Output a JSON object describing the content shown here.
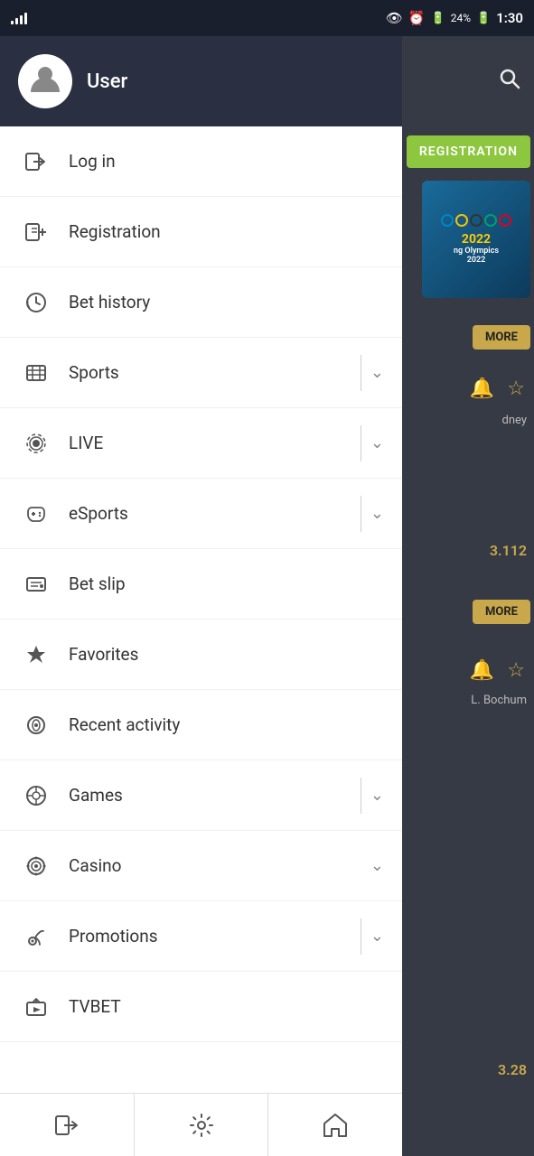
{
  "statusBar": {
    "time": "1:30",
    "battery": "24%"
  },
  "sidebar": {
    "username": "User",
    "items": [
      {
        "id": "login",
        "label": "Log in",
        "icon": "login",
        "hasChevron": false,
        "hasDivider": false
      },
      {
        "id": "registration",
        "label": "Registration",
        "icon": "registration",
        "hasChevron": false,
        "hasDivider": false
      },
      {
        "id": "bet-history",
        "label": "Bet history",
        "icon": "bet-history",
        "hasChevron": false,
        "hasDivider": false
      },
      {
        "id": "sports",
        "label": "Sports",
        "icon": "sports",
        "hasChevron": true,
        "hasDivider": true
      },
      {
        "id": "live",
        "label": "LIVE",
        "icon": "live",
        "hasChevron": true,
        "hasDivider": true
      },
      {
        "id": "esports",
        "label": "eSports",
        "icon": "esports",
        "hasChevron": true,
        "hasDivider": true
      },
      {
        "id": "bet-slip",
        "label": "Bet slip",
        "icon": "bet-slip",
        "hasChevron": false,
        "hasDivider": false
      },
      {
        "id": "favorites",
        "label": "Favorites",
        "icon": "favorites",
        "hasChevron": false,
        "hasDivider": false
      },
      {
        "id": "recent-activity",
        "label": "Recent activity",
        "icon": "recent-activity",
        "hasChevron": false,
        "hasDivider": false
      },
      {
        "id": "games",
        "label": "Games",
        "icon": "games",
        "hasChevron": true,
        "hasDivider": true
      },
      {
        "id": "casino",
        "label": "Casino",
        "icon": "casino",
        "hasChevron": true,
        "hasDivider": false
      },
      {
        "id": "promotions",
        "label": "Promotions",
        "icon": "promotions",
        "hasChevron": true,
        "hasDivider": true
      },
      {
        "id": "tvbet",
        "label": "TVBET",
        "icon": "tvbet",
        "hasChevron": false,
        "hasDivider": false
      }
    ],
    "bottomNav": [
      {
        "id": "logout",
        "icon": "logout"
      },
      {
        "id": "settings",
        "icon": "settings"
      },
      {
        "id": "home",
        "icon": "home"
      }
    ]
  },
  "rightPanel": {
    "registrationLabel": "REGISTRATION",
    "moreLabel1": "MORE",
    "moreLabel2": "MORE",
    "sydneyLabel": "dney",
    "bochumLabel": "L. Bochum",
    "score1": "3.112",
    "score2": "3.28",
    "beijingYear": "2022",
    "olympicsText": "ng Olympics\n2022"
  }
}
